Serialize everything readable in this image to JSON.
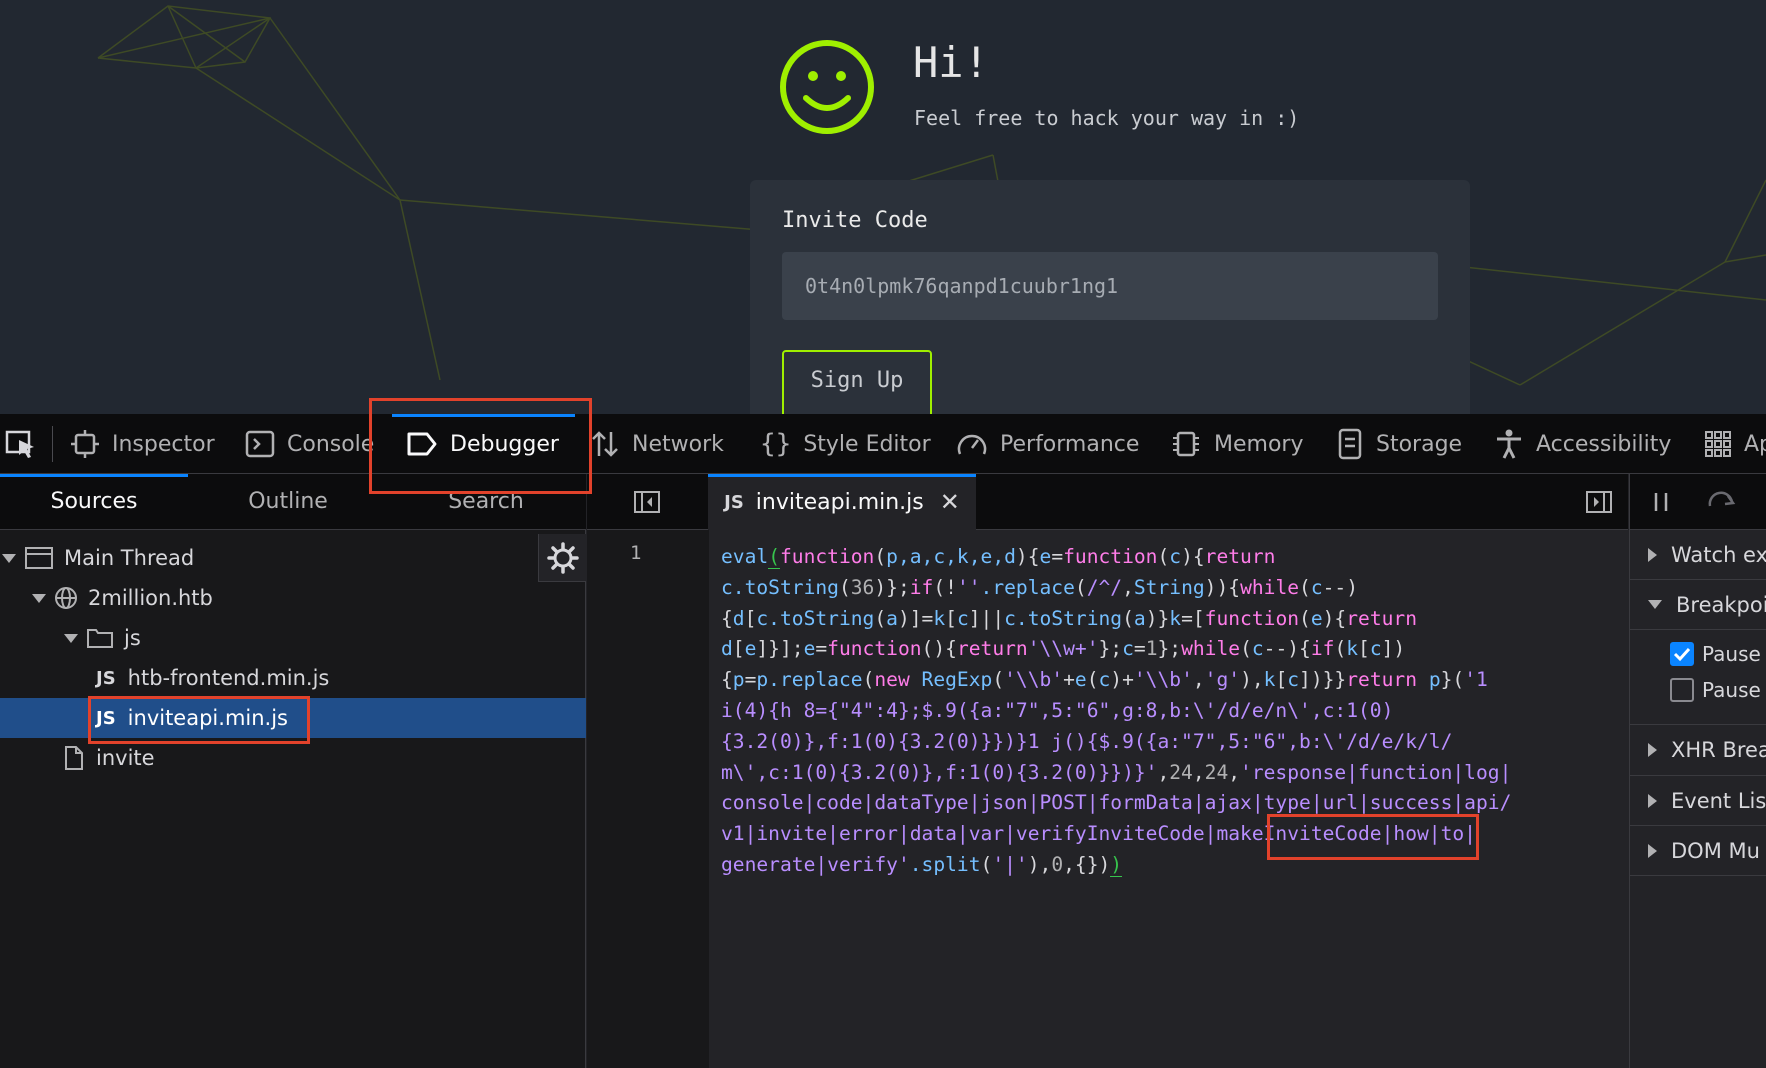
{
  "page": {
    "greeting": "Hi!",
    "subtitle": "Feel free to hack your way in :)",
    "invite_label": "Invite Code",
    "invite_value": "0t4n0lpmk76qanpd1cuubr1ng1",
    "signup_label": "Sign Up",
    "accent_color": "#9fef00"
  },
  "devtools": {
    "tabs": [
      {
        "label": "Inspector",
        "icon": "inspector-icon"
      },
      {
        "label": "Console",
        "icon": "console-icon"
      },
      {
        "label": "Debugger",
        "icon": "debugger-icon",
        "active": true
      },
      {
        "label": "Network",
        "icon": "network-icon"
      },
      {
        "label": "Style Editor",
        "icon": "style-editor-icon"
      },
      {
        "label": "Performance",
        "icon": "performance-icon"
      },
      {
        "label": "Memory",
        "icon": "memory-icon"
      },
      {
        "label": "Storage",
        "icon": "storage-icon"
      },
      {
        "label": "Accessibility",
        "icon": "accessibility-icon"
      },
      {
        "label": "Ap",
        "icon": "apps-grid-icon"
      }
    ],
    "sources_tabs": [
      "Sources",
      "Outline",
      "Search"
    ],
    "tree": {
      "thread": "Main Thread",
      "domain": "2million.htb",
      "folder": "js",
      "files": [
        "htb-frontend.min.js",
        "inviteapi.min.js"
      ],
      "doc": "invite"
    },
    "editor": {
      "file_tab": "inviteapi.min.js",
      "file_badge": "JS",
      "line_number": "1"
    },
    "right_pane": {
      "watch": "Watch ex",
      "breakpoints": "Breakpoi",
      "pause1": "Pause",
      "pause2": "Pause",
      "xhr": "XHR Brea",
      "events": "Event Lis",
      "dom": "DOM Mu"
    },
    "highlight_color": "#e2422b",
    "active_color": "#0a84ff"
  }
}
